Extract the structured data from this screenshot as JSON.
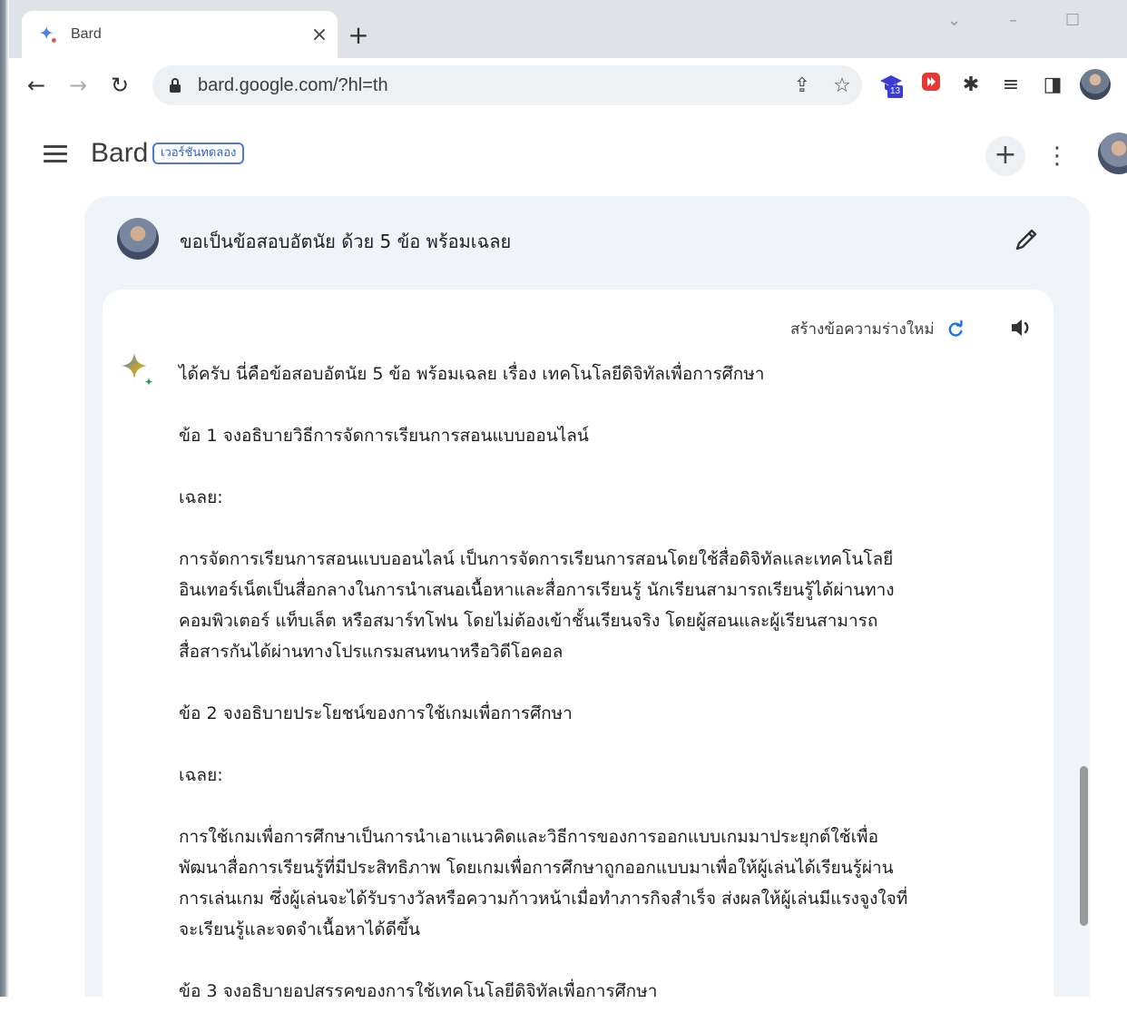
{
  "browser": {
    "tab_title": "Bard",
    "url": "bard.google.com/?hl=th",
    "extension_badge": "13"
  },
  "app": {
    "brand": "Bard",
    "beta_label": "เวอร์ชันทดลอง",
    "new_chat_symbol": "+",
    "more_symbol": "⋮"
  },
  "conversation": {
    "user_query": "ขอเป็นข้อสอบอัตนัย ด้วย 5 ข้อ พร้อมเฉลย",
    "regenerate_label": "สร้างข้อความร่างใหม่",
    "response": {
      "intro": "ได้ครับ นี่คือข้อสอบอัตนัย 5 ข้อ พร้อมเฉลย เรื่อง เทคโนโลยีดิจิทัลเพื่อการศึกษา",
      "q1": "ข้อ 1 จงอธิบายวิธีการจัดการเรียนการสอนแบบออนไลน์",
      "answer_label": "เฉลย:",
      "a1": [
        "การจัดการเรียนการสอนแบบออนไลน์ เป็นการจัดการเรียนการสอนโดยใช้สื่อดิจิทัลและเทคโนโลยี",
        "อินเทอร์เน็ตเป็นสื่อกลางในการนำเสนอเนื้อหาและสื่อการเรียนรู้ นักเรียนสามารถเรียนรู้ได้ผ่านทาง",
        "คอมพิวเตอร์ แท็บเล็ต หรือสมาร์ทโฟน โดยไม่ต้องเข้าชั้นเรียนจริง โดยผู้สอนและผู้เรียนสามารถ",
        "สื่อสารกันได้ผ่านทางโปรแกรมสนทนาหรือวิดีโอคอล"
      ],
      "q2": "ข้อ 2 จงอธิบายประโยชน์ของการใช้เกมเพื่อการศึกษา",
      "a2": [
        "การใช้เกมเพื่อการศึกษาเป็นการนำเอาแนวคิดและวิธีการของการออกแบบเกมมาประยุกต์ใช้เพื่อ",
        "พัฒนาสื่อการเรียนรู้ที่มีประสิทธิภาพ โดยเกมเพื่อการศึกษาถูกออกแบบมาเพื่อให้ผู้เล่นได้เรียนรู้ผ่าน",
        "การเล่นเกม ซึ่งผู้เล่นจะได้รับรางวัลหรือความก้าวหน้าเมื่อทำภารกิจสำเร็จ ส่งผลให้ผู้เล่นมีแรงจูงใจที่",
        "จะเรียนรู้และจดจำเนื้อหาได้ดีขึ้น"
      ],
      "q3": "ข้อ 3 จงอธิบายอุปสรรคของการใช้เทคโนโลยีดิจิทัลเพื่อการศึกษา"
    }
  },
  "colors": {
    "accent_blue": "#1a73e8",
    "surface": "#f0f4f9",
    "chrome_bg": "#dfe3e7"
  }
}
